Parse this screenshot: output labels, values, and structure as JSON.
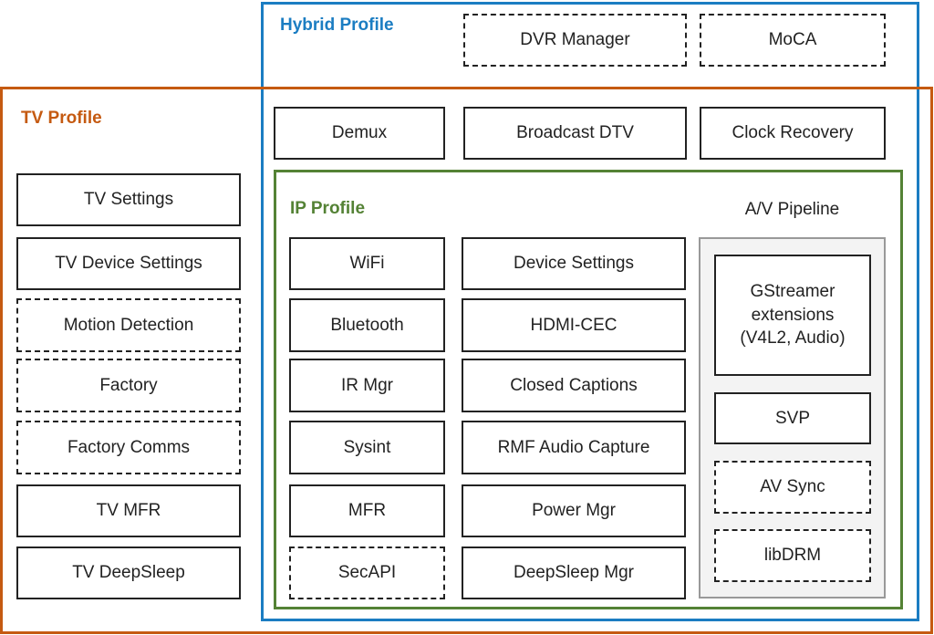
{
  "colors": {
    "hybrid": "#1b7dc2",
    "tv": "#c55a11",
    "ip": "#548235",
    "pipeline_bg": "#f3f3f3"
  },
  "hybrid": {
    "title": "Hybrid Profile",
    "optional": [
      "DVR Manager",
      "MoCA"
    ],
    "items": [
      "Demux",
      "Broadcast DTV",
      "Clock Recovery"
    ]
  },
  "tv": {
    "title": "TV Profile",
    "items": [
      "TV Settings",
      "TV Device Settings",
      "Motion Detection",
      "Factory",
      "Factory Comms",
      "TV MFR",
      "TV DeepSleep"
    ]
  },
  "ip": {
    "title": "IP Profile",
    "col1": [
      "WiFi",
      "Bluetooth",
      "IR Mgr",
      "Sysint",
      "MFR",
      "SecAPI"
    ],
    "col2": [
      "Device Settings",
      "HDMI-CEC",
      "Closed Captions",
      "RMF Audio Capture",
      "Power Mgr",
      "DeepSleep Mgr"
    ]
  },
  "pipeline": {
    "title": "A/V Pipeline",
    "items": [
      "GStreamer extensions (V4L2, Audio)",
      "SVP",
      "AV Sync",
      "libDRM"
    ]
  }
}
